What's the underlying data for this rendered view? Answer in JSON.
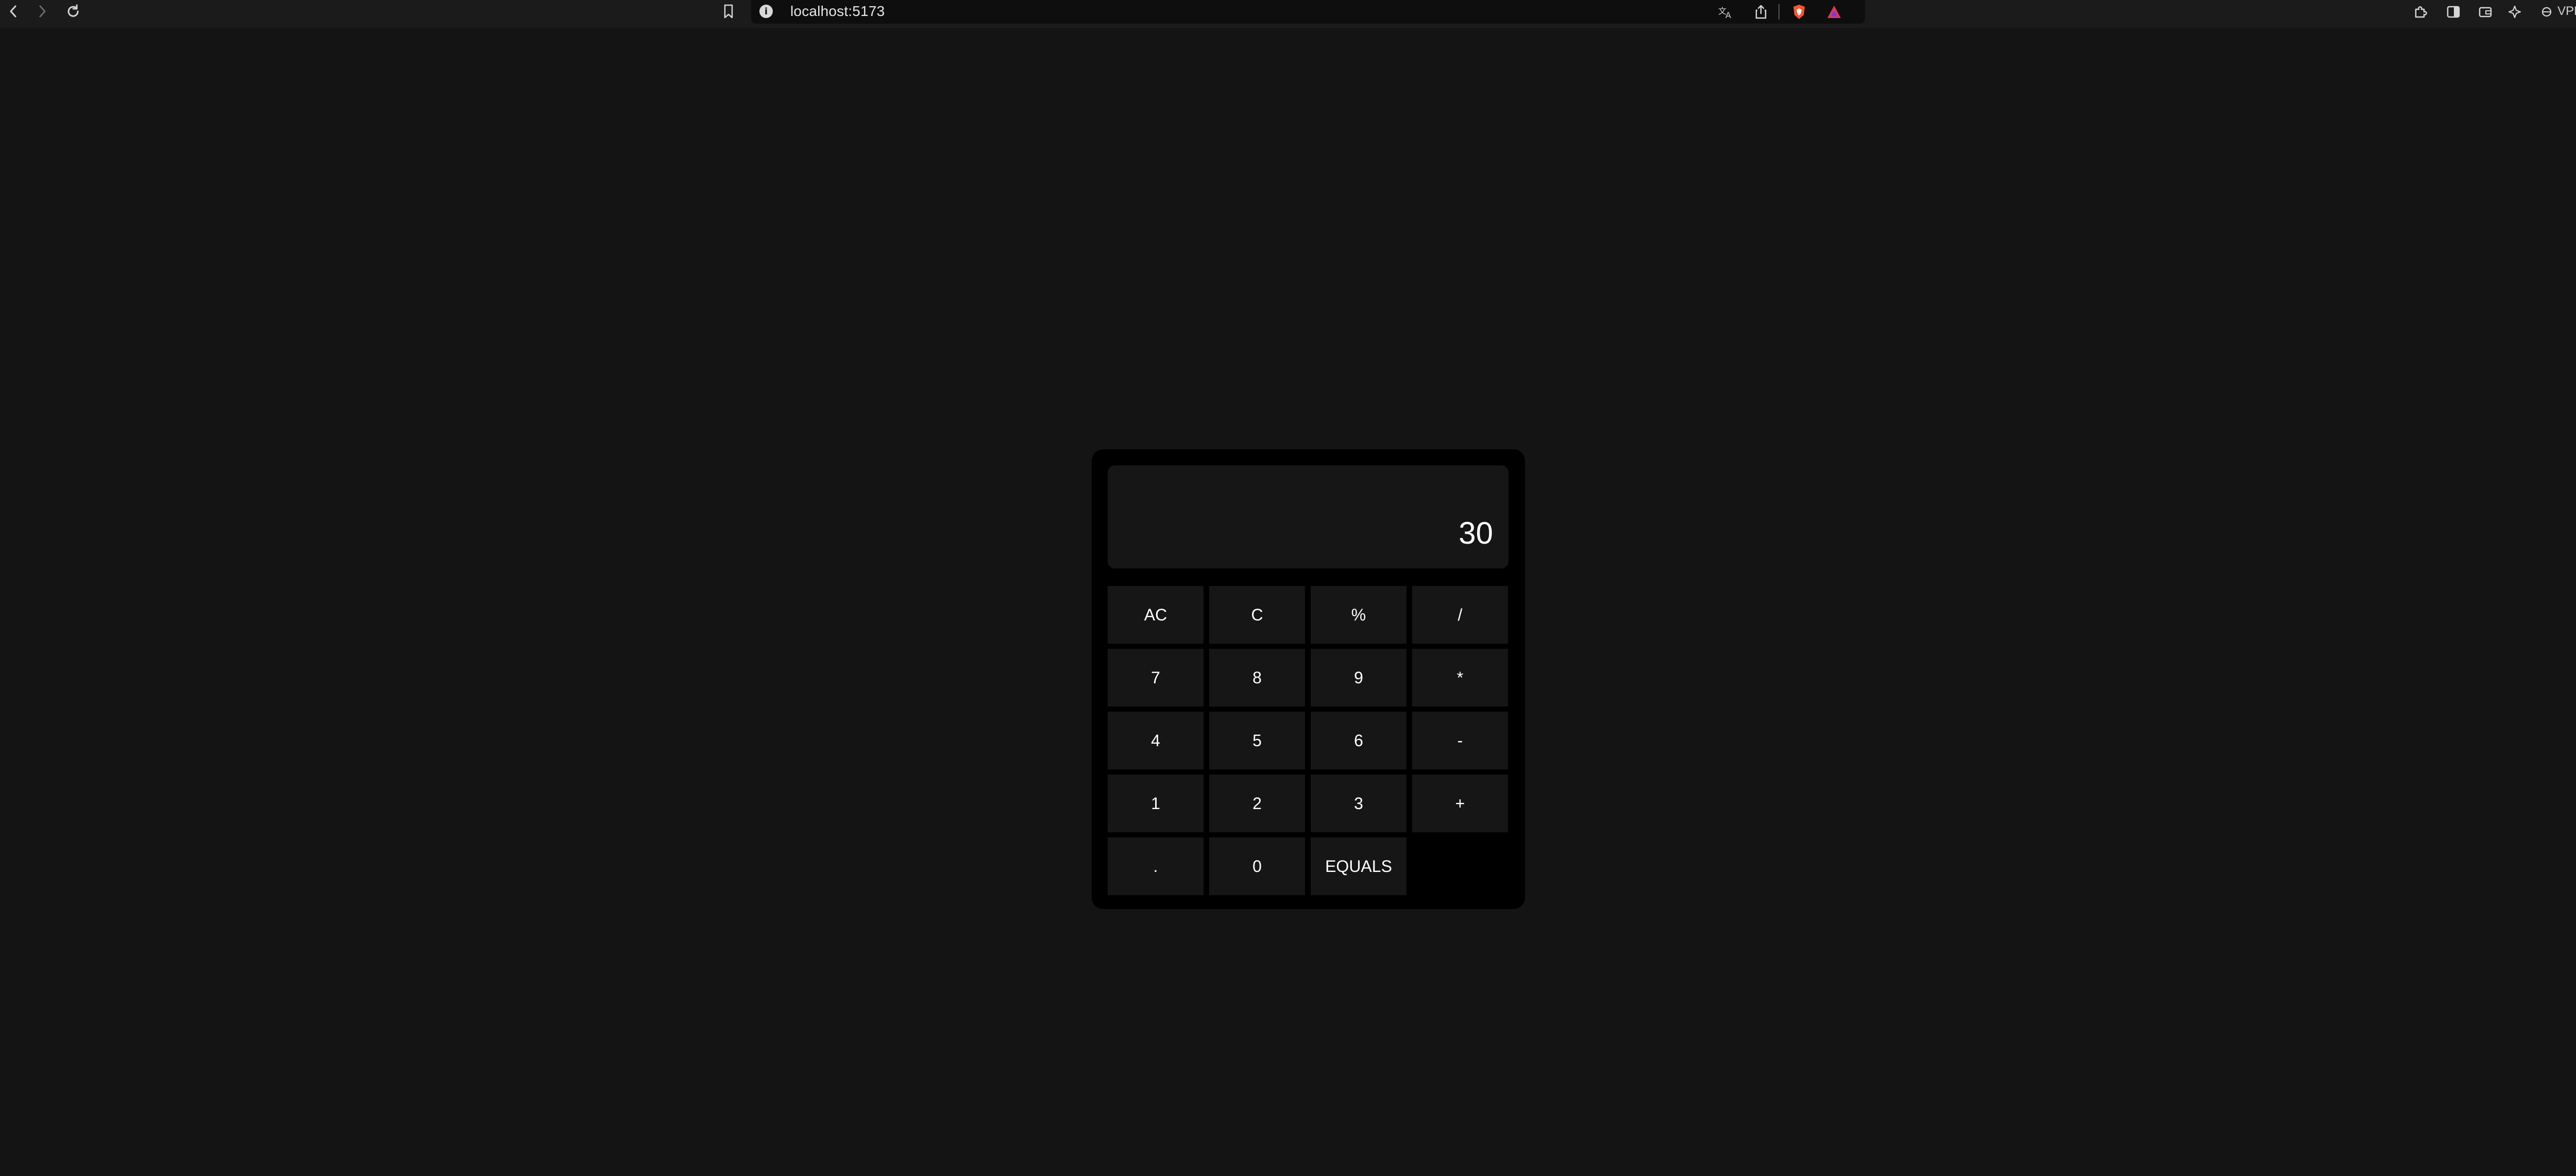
{
  "browser": {
    "url": "localhost:5173",
    "vpn_label": "VPN",
    "info_icon": "i"
  },
  "calculator": {
    "display": "30",
    "keys": [
      "AC",
      "C",
      "%",
      "/",
      "7",
      "8",
      "9",
      "*",
      "4",
      "5",
      "6",
      "-",
      "1",
      "2",
      "3",
      "+",
      ".",
      "0",
      "EQUALS"
    ]
  },
  "colors": {
    "page_background": "#141414",
    "calculator_body": "#000000",
    "key_background": "#161616",
    "text": "#ffffff"
  }
}
